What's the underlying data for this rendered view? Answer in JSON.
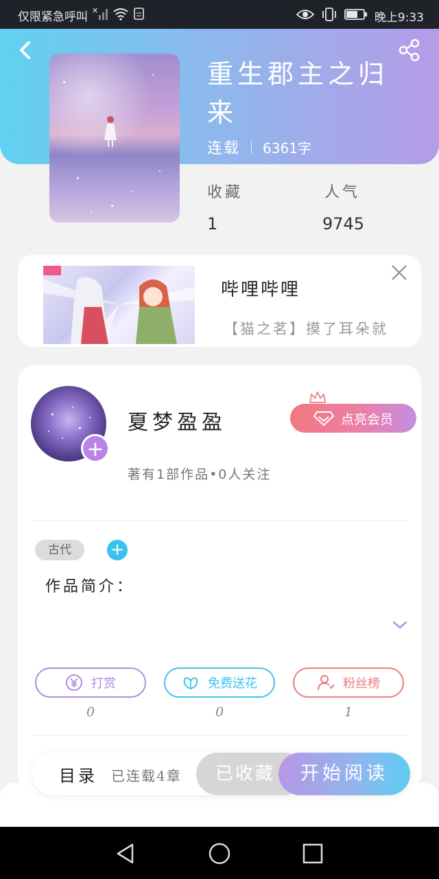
{
  "status_bar": {
    "left_text": "仅限紧急呼叫",
    "time": "晚上9:33",
    "icons": [
      "no-signal-icon",
      "wifi-icon",
      "sim-icon",
      "eye-icon",
      "vibrate-icon",
      "battery-icon"
    ]
  },
  "book": {
    "title": "重生郡主之归来",
    "status": "连载",
    "word_count": "6361字",
    "stats": [
      {
        "label": "收藏",
        "value": "1"
      },
      {
        "label": "人气",
        "value": "9745"
      }
    ]
  },
  "ad": {
    "title": "哔哩哔哩",
    "description": "【猫之茗】摸了耳朵就"
  },
  "author": {
    "name": "夏梦盈盈",
    "meta": "著有1部作品•0人关注",
    "vip_label": "点亮会员"
  },
  "tags": [
    "古代"
  ],
  "intro_label": "作品简介：",
  "actions": [
    {
      "label": "打赏",
      "count": "0",
      "color": "#b08ae0",
      "icon": "yuan-icon"
    },
    {
      "label": "免费送花",
      "count": "0",
      "color": "#3ec3ef",
      "icon": "flower-icon"
    },
    {
      "label": "粉丝榜",
      "count": "1",
      "color": "#ec7b80",
      "icon": "fan-rank-icon"
    }
  ],
  "bottom_bar": {
    "toc_label": "目录",
    "chapters_label": "已连载4章",
    "collected_label": "已收藏",
    "read_label": "开始阅读"
  },
  "colors": {
    "header_gradient": [
      "#5fd2f1",
      "#b69be6"
    ],
    "vip_gradient": [
      "#f2787e",
      "#c48ee0"
    ],
    "tag_add": "#39c1ef"
  }
}
